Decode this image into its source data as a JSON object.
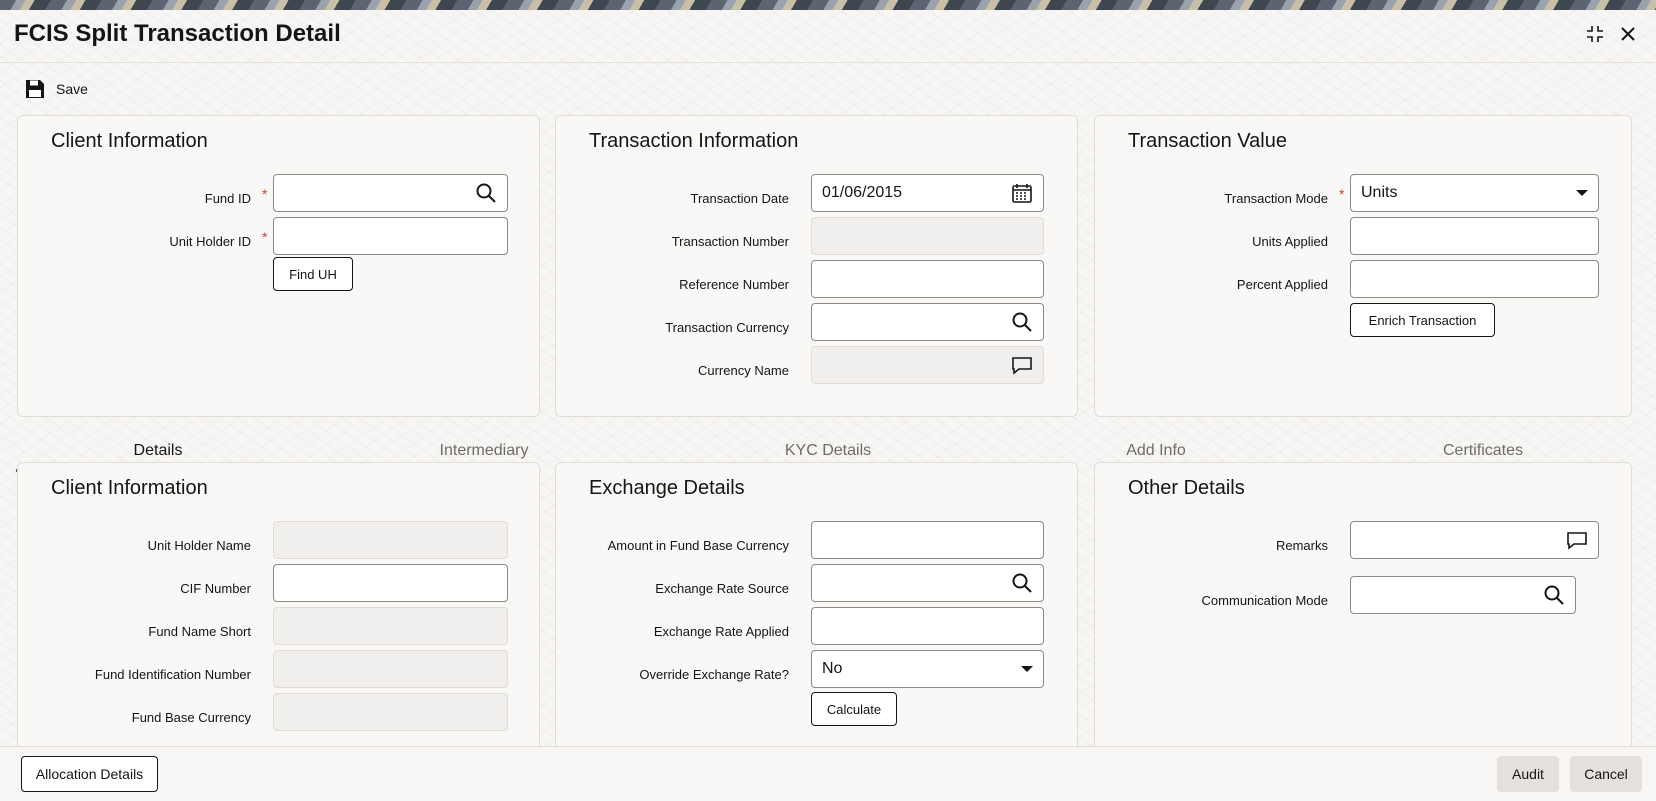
{
  "window": {
    "title": "FCIS Split Transaction Detail"
  },
  "toolbar": {
    "save_label": "Save"
  },
  "client_info": {
    "heading": "Client Information",
    "fund_id_label": "Fund ID",
    "fund_id_value": "",
    "unit_holder_id_label": "Unit Holder ID",
    "unit_holder_id_value": "",
    "find_uh_label": "Find UH"
  },
  "transaction_info": {
    "heading": "Transaction Information",
    "transaction_date_label": "Transaction Date",
    "transaction_date_value": "01/06/2015",
    "transaction_number_label": "Transaction Number",
    "transaction_number_value": "",
    "reference_number_label": "Reference Number",
    "reference_number_value": "",
    "transaction_currency_label": "Transaction Currency",
    "transaction_currency_value": "",
    "currency_name_label": "Currency Name",
    "currency_name_value": ""
  },
  "transaction_value": {
    "heading": "Transaction Value",
    "transaction_mode_label": "Transaction Mode",
    "transaction_mode_value": "Units",
    "units_applied_label": "Units Applied",
    "units_applied_value": "",
    "percent_applied_label": "Percent Applied",
    "percent_applied_value": "",
    "enrich_label": "Enrich Transaction"
  },
  "tabs": [
    {
      "label": "Details"
    },
    {
      "label": "Intermediary"
    },
    {
      "label": "KYC Details"
    },
    {
      "label": "Add Info"
    },
    {
      "label": "Certificates"
    }
  ],
  "details_client": {
    "heading": "Client Information",
    "unit_holder_name_label": "Unit Holder Name",
    "unit_holder_name_value": "",
    "cif_number_label": "CIF Number",
    "cif_number_value": "",
    "fund_name_short_label": "Fund Name Short",
    "fund_name_short_value": "",
    "fund_identification_label": "Fund Identification Number",
    "fund_identification_value": "",
    "fund_base_currency_label": "Fund Base Currency",
    "fund_base_currency_value": ""
  },
  "exchange": {
    "heading": "Exchange Details",
    "amount_label": "Amount in Fund Base Currency",
    "amount_value": "",
    "rate_source_label": "Exchange Rate Source",
    "rate_source_value": "",
    "rate_applied_label": "Exchange Rate Applied",
    "rate_applied_value": "",
    "override_label": "Override Exchange Rate?",
    "override_value": "No",
    "calculate_label": "Calculate"
  },
  "other": {
    "heading": "Other Details",
    "remarks_label": "Remarks",
    "remarks_value": "",
    "comm_mode_label": "Communication Mode",
    "comm_mode_value": ""
  },
  "footer": {
    "allocation_label": "Allocation Details",
    "audit_label": "Audit",
    "cancel_label": "Cancel"
  },
  "colors": {
    "required": "#c74634",
    "tab_active_underline": "#4f5a73"
  }
}
